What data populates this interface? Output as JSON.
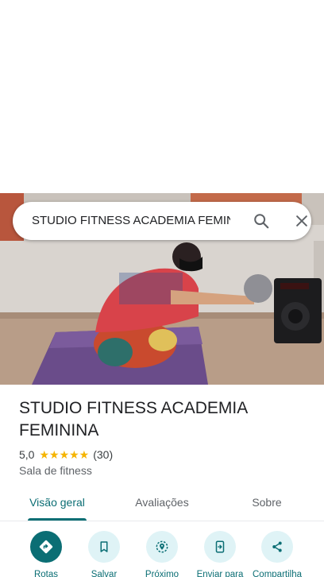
{
  "search": {
    "query": "STUDIO FITNESS ACADEMIA FEMININA"
  },
  "place": {
    "name": "STUDIO FITNESS ACADEMIA FEMININA",
    "rating": "5,0",
    "stars": "★★★★★",
    "review_count": "(30)",
    "category": "Sala de fitness"
  },
  "tabs": [
    {
      "label": "Visão geral",
      "active": true
    },
    {
      "label": "Avaliações",
      "active": false
    },
    {
      "label": "Sobre",
      "active": false
    }
  ],
  "actions": [
    {
      "label": "Rotas",
      "icon": "directions-icon"
    },
    {
      "label": "Salvar",
      "icon": "bookmark-icon"
    },
    {
      "label": "Próximo",
      "icon": "nearby-icon"
    },
    {
      "label": "Enviar para",
      "icon": "send-to-phone-icon"
    },
    {
      "label": "Compartilha",
      "icon": "share-icon"
    }
  ],
  "colors": {
    "accent": "#0b6e74",
    "accent_light": "#dff3f6",
    "star": "#f5b400"
  }
}
